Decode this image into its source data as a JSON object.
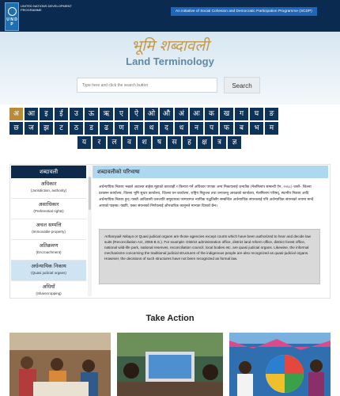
{
  "header": {
    "logo_letters": "U N D P",
    "org_name": "UNITED NATIONS DEVELOPMENT PROGRAMME",
    "program": "An initiative of Social Cohesion and Democratic Participation Programme (SCDP)"
  },
  "hero": {
    "title_np": "भूमि शब्दावली",
    "title_en": "Land Terminology"
  },
  "search": {
    "placeholder": "Type here and click the search button",
    "button_label": "Search"
  },
  "alphabet": {
    "row1": [
      "अ",
      "आ",
      "इ",
      "ई",
      "उ",
      "ऊ",
      "ऋ",
      "ए",
      "ऐ",
      "ओ",
      "औ",
      "अं",
      "अः",
      "क",
      "ख",
      "ग",
      "घ",
      "ङ"
    ],
    "row2": [
      "छ",
      "ज",
      "झ",
      "ट",
      "ठ",
      "ड",
      "ढ",
      "ण",
      "त",
      "थ",
      "द",
      "ध",
      "न",
      "प",
      "फ",
      "ब",
      "भ",
      "म"
    ],
    "row3": [
      "य",
      "र",
      "ल",
      "व",
      "श",
      "ष",
      "स",
      "ह",
      "क्ष",
      "त्र",
      "ज्ञ"
    ],
    "active": "अ"
  },
  "glossary": {
    "sidebar_title": "शब्दावली",
    "terms": [
      {
        "np": "अधिकार",
        "en": "(Jurisdiction, authority)"
      },
      {
        "np": "असाधिकार",
        "en": "(Preferential rights)"
      },
      {
        "np": "अचल सम्पत्ति",
        "en": "(Immovable property)"
      },
      {
        "np": "अतिक्रमण",
        "en": "(Encroachment)"
      },
      {
        "np": "अर्धन्यायिक निकाय",
        "en": "(Quasi judicial organs)"
      },
      {
        "np": "अधियाँ",
        "en": "(Sharecropping)"
      }
    ],
    "active_index": 4,
    "definition_title": "शब्दावलीको परिभाषा",
    "definition_np": "अर्धन्यायिक निकाय भन्नाले अदालत बाहेक मुद्दाको कारवाही र किनारा गर्ने अधिकार पाएका अन्य निकायलाई जनाउँछ (मेलमिलाप सम्बन्धी ऐन, २०६८) जस्तै– जिल्ला प्रशासन कार्यालय, जिल्ला भूमि सुधार कार्यालय, जिल्ला वन कार्यालय, राष्ट्रिय निकुञ्ज तथा वन्यजन्तु आरक्षको कार्यालय, मेलमिलाप परिषद्, स्थानीय निकाय आदि अर्धन्यायिक निकाय हुन्। यसरी आदिवासी जनजाति समुदायका परम्परागत न्यायिक पद्धतिसँग सम्बन्धित अर्धन्यायिक संयन्त्रलाई पनि अर्धन्यायिक संयन्त्रको रूपमा मान्दै आएको पाइन्छ। यद्यपि, यस्ता संयन्त्रको निर्णयलाई औपचारिक कानूनले मान्यता दिएको छैन।",
    "definition_en_term": "Arthanyaik Nikaya",
    "definition_en_body": " or Quasi judicial organs are those agencies except courts which have been authorized to hear and decide law suits (Reconciliation Act, 2066 B.S.). For example: District administration office, district land reform office, district forest office, national wild-life park, national reserves, reconciliation council, local bodies etc. are quasi judicial organs. Likewise, the informal mechanisms concerning the traditional judicial structures of the indigenous people are also recognized as quasi-judicial organs. However, the decisions of such structures have not been recognized as formal law."
  },
  "take_action": {
    "title": "Take Action"
  }
}
